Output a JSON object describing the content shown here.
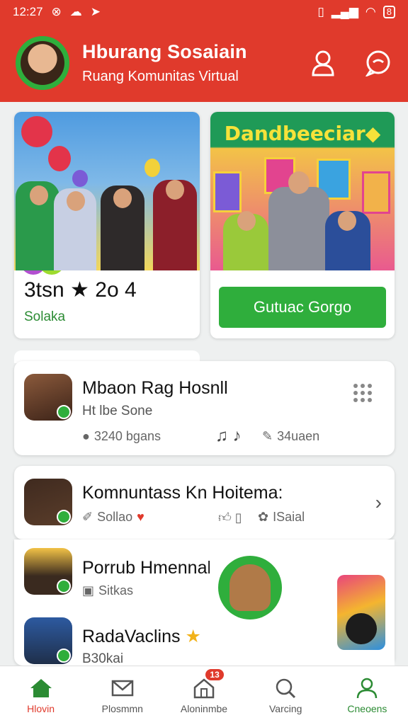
{
  "status_bar": {
    "time": "12:27",
    "battery": "8"
  },
  "header": {
    "title": "Hburang Sosaiain",
    "subtitle": "Ruang Komunitas Virtual"
  },
  "cards": {
    "left": {
      "stat": "3tsn ★ 2o 4",
      "tag": "Solaka"
    },
    "right": {
      "banner": "Dandbeeciar◆",
      "button": "Gutuac Gorgo"
    }
  },
  "rows": [
    {
      "name": "Mbaon Rag Hosnll",
      "sub": "Ht lbe Sone",
      "meta1": "3240 bgans",
      "meta2": "34uaen"
    },
    {
      "name": "Komnuntass Kn Hoitema:",
      "meta1": "Sollao",
      "meta2": "ISaial"
    },
    {
      "name": "Porrub Hmennal lo ...kal",
      "meta1": "Sitkas"
    },
    {
      "name": "RadaVaclins",
      "sub": "B30kai"
    }
  ],
  "nav": [
    {
      "label": "Hlovin"
    },
    {
      "label": "Plosmmn"
    },
    {
      "label": "Aloninmbe",
      "badge": "13"
    },
    {
      "label": "Varcing"
    },
    {
      "label": "Cneoens"
    }
  ]
}
